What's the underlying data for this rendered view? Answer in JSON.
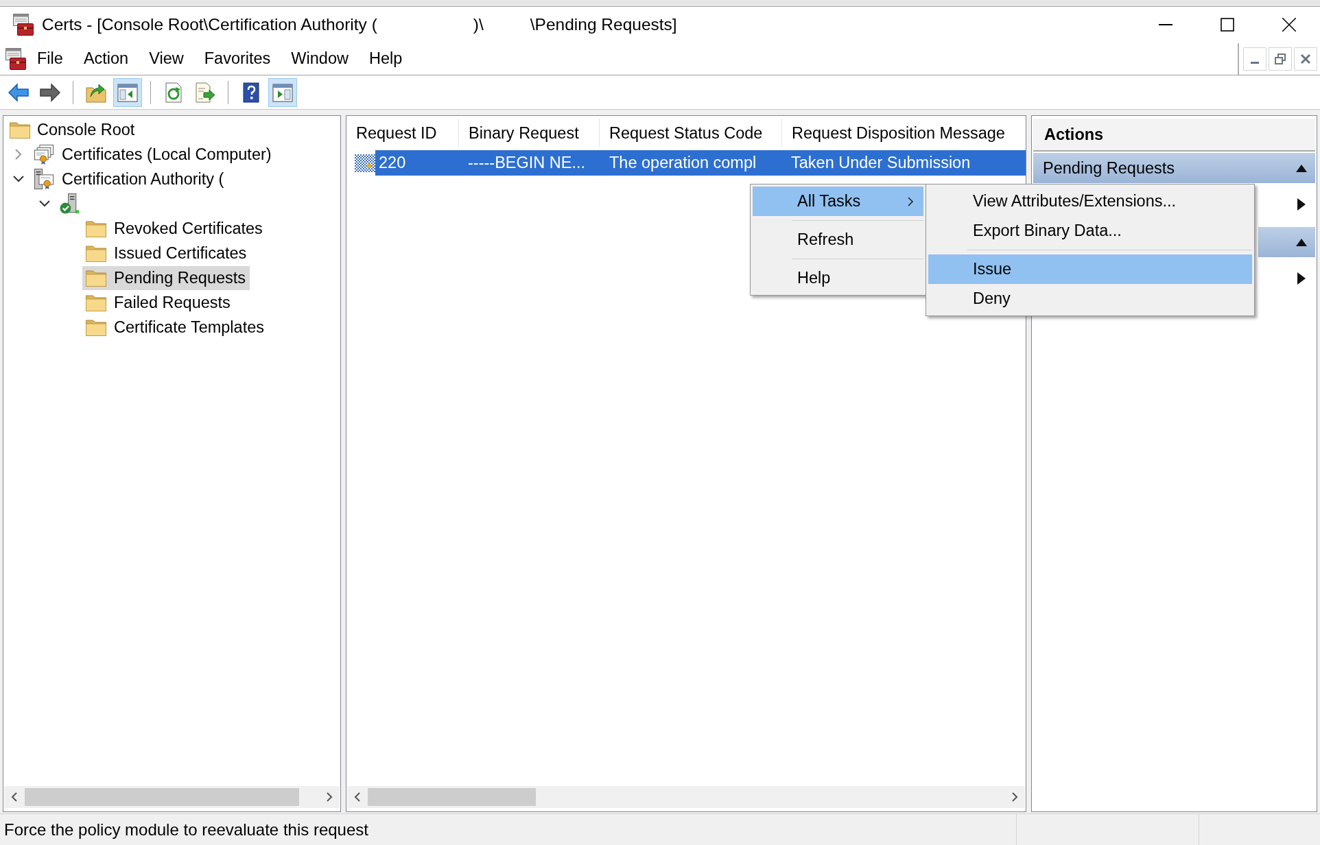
{
  "window": {
    "title_parts": [
      "Certs - [Console Root\\Certification Authority (",
      ")\\",
      "\\Pending Requests]"
    ]
  },
  "menu_bar": [
    "File",
    "Action",
    "View",
    "Favorites",
    "Window",
    "Help"
  ],
  "toolbar": [
    {
      "kind": "back",
      "disabled": false,
      "on": false
    },
    {
      "kind": "forward",
      "disabled": true,
      "on": false
    },
    {
      "kind": "separator"
    },
    {
      "kind": "up",
      "disabled": false,
      "on": false
    },
    {
      "kind": "console_tree",
      "disabled": false,
      "on": true
    },
    {
      "kind": "separator"
    },
    {
      "kind": "refresh",
      "disabled": false,
      "on": false
    },
    {
      "kind": "export",
      "disabled": false,
      "on": false
    },
    {
      "kind": "separator"
    },
    {
      "kind": "help",
      "disabled": false,
      "on": false
    },
    {
      "kind": "action_pane",
      "disabled": false,
      "on": true
    }
  ],
  "tree": [
    {
      "label": "Console Root",
      "kind": "folder",
      "selected": false,
      "children": [
        {
          "label": "Certificates (Local Computer)",
          "kind": "certificates",
          "expanded": false,
          "selected": false
        },
        {
          "label": "Certification Authority (",
          "kind": "authority",
          "expanded": true,
          "selected": false,
          "children": [
            {
              "kind": "server",
              "expanded": true,
              "selected": false,
              "children": [
                {
                  "label": "Revoked Certificates",
                  "kind": "folder",
                  "selected": false
                },
                {
                  "label": "Issued Certificates",
                  "kind": "folder",
                  "selected": false
                },
                {
                  "label": "Pending Requests",
                  "kind": "folder",
                  "selected": true
                },
                {
                  "label": "Failed Requests",
                  "kind": "folder",
                  "selected": false
                },
                {
                  "label": "Certificate Templates",
                  "kind": "folder",
                  "selected": false
                }
              ]
            }
          ]
        }
      ]
    }
  ],
  "list": {
    "columns": [
      "Request ID",
      "Binary Request",
      "Request Status Code",
      "Request Disposition Message"
    ],
    "rows": [
      {
        "selected": true,
        "cells": [
          "220",
          "-----BEGIN NE...",
          "The operation compl",
          "Taken Under Submission"
        ]
      }
    ]
  },
  "context_menu": {
    "items": [
      {
        "kind": "submenu",
        "label": "All Tasks",
        "selected": true
      },
      {
        "kind": "separator"
      },
      {
        "kind": "command",
        "label": "Refresh",
        "selected": false
      },
      {
        "kind": "separator"
      },
      {
        "kind": "command",
        "label": "Help",
        "selected": false
      }
    ]
  },
  "submenu": {
    "items": [
      {
        "kind": "command",
        "label": "View Attributes/Extensions...",
        "selected": false
      },
      {
        "kind": "command",
        "label": "Export Binary Data...",
        "selected": false
      },
      {
        "kind": "separator"
      },
      {
        "kind": "command",
        "label": "Issue",
        "selected": true
      },
      {
        "kind": "command",
        "label": "Deny",
        "selected": false
      }
    ]
  },
  "actions": {
    "title": "Actions",
    "sections": [
      {
        "title": "Pending Requests",
        "expanded": true,
        "items": [
          {
            "kind": "submenu"
          }
        ]
      },
      {
        "expanded": true,
        "items": [
          {
            "kind": "submenu"
          }
        ]
      }
    ]
  },
  "status_bar": {
    "text": "Force the policy module to reevaluate this request"
  }
}
